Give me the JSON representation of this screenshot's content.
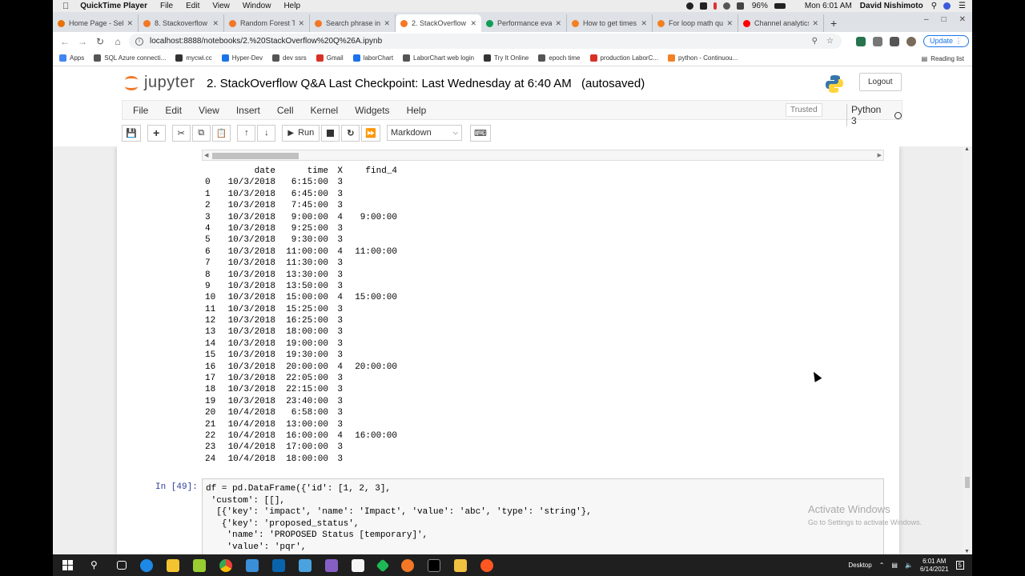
{
  "mac_menubar": {
    "app": "QuickTime Player",
    "menus": [
      "File",
      "Edit",
      "View",
      "Window",
      "Help"
    ],
    "battery": "96%",
    "datetime": "Mon 6:01 AM",
    "user": "David Nishimoto"
  },
  "tabs": [
    {
      "label": "Home Page - Sele",
      "color": "#e8710a"
    },
    {
      "label": "8. Stackoverflow",
      "color": "#f37726"
    },
    {
      "label": "Random Forest Te",
      "color": "#f37726"
    },
    {
      "label": "Search phrase in t",
      "color": "#f37726"
    },
    {
      "label": "2. StackOverflow",
      "color": "#f37726",
      "active": true
    },
    {
      "label": "Performance eval",
      "color": "#0f9d58"
    },
    {
      "label": "How to get times",
      "color": "#f48024"
    },
    {
      "label": "For loop math qu",
      "color": "#f48024"
    },
    {
      "label": "Channel analytics",
      "color": "#ff0000"
    }
  ],
  "address": {
    "url": "localhost:8888/notebooks/2.%20StackOverflow%20Q%26A.ipynb",
    "update_label": "Update"
  },
  "bookmarks": [
    {
      "label": "Apps",
      "color": "#4285f4"
    },
    {
      "label": "SQL Azure connecti...",
      "color": "#555"
    },
    {
      "label": "mycwi.cc",
      "color": "#333"
    },
    {
      "label": "Hyper-Dev",
      "color": "#1a73e8"
    },
    {
      "label": "dev ssrs",
      "color": "#555"
    },
    {
      "label": "Gmail",
      "color": "#d93025"
    },
    {
      "label": "laborChart",
      "color": "#1a73e8"
    },
    {
      "label": "LaborChart web login",
      "color": "#555"
    },
    {
      "label": "Try It Online",
      "color": "#333"
    },
    {
      "label": "epoch time",
      "color": "#555"
    },
    {
      "label": "production LaborC...",
      "color": "#d93025"
    },
    {
      "label": "python - Continuou...",
      "color": "#f48024"
    }
  ],
  "reading_list": "Reading list",
  "jupyter": {
    "logo_text": "jupyter",
    "notebook_name": "2. StackOverflow Q&A",
    "checkpoint": "Last Checkpoint: Last Wednesday at 6:40 AM",
    "autosave": "(autosaved)",
    "logout": "Logout",
    "menu": [
      "File",
      "Edit",
      "View",
      "Insert",
      "Cell",
      "Kernel",
      "Widgets",
      "Help"
    ],
    "trusted": "Trusted",
    "kernel": "Python 3",
    "run_label": "Run",
    "cell_type": "Markdown"
  },
  "dataframe": {
    "columns": [
      "date",
      "time",
      "X",
      "find_4"
    ],
    "rows": [
      [
        "0",
        "10/3/2018",
        "6:15:00",
        "3",
        ""
      ],
      [
        "1",
        "10/3/2018",
        "6:45:00",
        "3",
        ""
      ],
      [
        "2",
        "10/3/2018",
        "7:45:00",
        "3",
        ""
      ],
      [
        "3",
        "10/3/2018",
        "9:00:00",
        "4",
        "9:00:00"
      ],
      [
        "4",
        "10/3/2018",
        "9:25:00",
        "3",
        ""
      ],
      [
        "5",
        "10/3/2018",
        "9:30:00",
        "3",
        ""
      ],
      [
        "6",
        "10/3/2018",
        "11:00:00",
        "4",
        "11:00:00"
      ],
      [
        "7",
        "10/3/2018",
        "11:30:00",
        "3",
        ""
      ],
      [
        "8",
        "10/3/2018",
        "13:30:00",
        "3",
        ""
      ],
      [
        "9",
        "10/3/2018",
        "13:50:00",
        "3",
        ""
      ],
      [
        "10",
        "10/3/2018",
        "15:00:00",
        "4",
        "15:00:00"
      ],
      [
        "11",
        "10/3/2018",
        "15:25:00",
        "3",
        ""
      ],
      [
        "12",
        "10/3/2018",
        "16:25:00",
        "3",
        ""
      ],
      [
        "13",
        "10/3/2018",
        "18:00:00",
        "3",
        ""
      ],
      [
        "14",
        "10/3/2018",
        "19:00:00",
        "3",
        ""
      ],
      [
        "15",
        "10/3/2018",
        "19:30:00",
        "3",
        ""
      ],
      [
        "16",
        "10/3/2018",
        "20:00:00",
        "4",
        "20:00:00"
      ],
      [
        "17",
        "10/3/2018",
        "22:05:00",
        "3",
        ""
      ],
      [
        "18",
        "10/3/2018",
        "22:15:00",
        "3",
        ""
      ],
      [
        "19",
        "10/3/2018",
        "23:40:00",
        "3",
        ""
      ],
      [
        "20",
        "10/4/2018",
        "6:58:00",
        "3",
        ""
      ],
      [
        "21",
        "10/4/2018",
        "13:00:00",
        "3",
        ""
      ],
      [
        "22",
        "10/4/2018",
        "16:00:00",
        "4",
        "16:00:00"
      ],
      [
        "23",
        "10/4/2018",
        "17:00:00",
        "3",
        ""
      ],
      [
        "24",
        "10/4/2018",
        "18:00:00",
        "3",
        ""
      ]
    ]
  },
  "code_cell": {
    "prompt": "In [49]:",
    "lines": [
      "df = pd.DataFrame({'id': [1, 2, 3],",
      " 'custom': [[],",
      "  [{'key': 'impact', 'name': 'Impact', 'value': 'abc', 'type': 'string'},",
      "   {'key': 'proposed_status',",
      "    'name': 'PROPOSED Status [temporary]',",
      "    'value': 'pqr',"
    ]
  },
  "watermark": {
    "title": "Activate Windows",
    "subtitle": "Go to Settings to activate Windows."
  },
  "taskbar": {
    "desktop_label": "Desktop",
    "time": "6:01 AM",
    "date": "6/14/2021",
    "notifications": "5"
  }
}
